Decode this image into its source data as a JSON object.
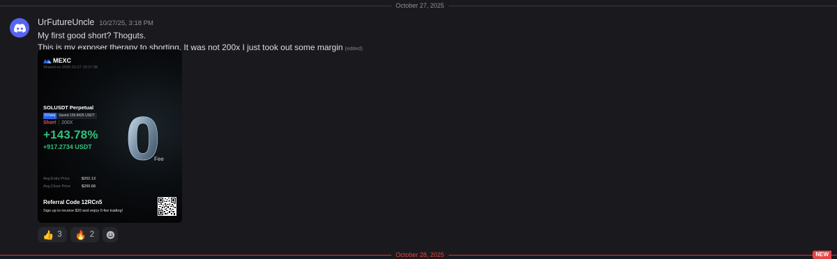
{
  "dividers": {
    "top_date": "October 27, 2025",
    "bottom_date": "October 28, 2025",
    "new_badge": "NEW"
  },
  "message": {
    "author": "UrFutureUncle",
    "timestamp": "10/27/25, 3:18 PM",
    "lines": [
      "My first good short? Thoguts.",
      "This is my exposer therapy to shorting. It was not 200x I just took out some margin"
    ],
    "edited_label": "(edited)"
  },
  "card": {
    "brand": "MEXC",
    "shared_on": "Shared on 2025-10-27 15:17:38",
    "pair": "SOLUSDT Perpetual",
    "fee_badge": "0 Fees",
    "fee_saved": "Saved 139.8425 USDT",
    "direction": "Short",
    "leverage": "200X",
    "pnl_percent": "+143.78%",
    "pnl_usdt": "+917.2734 USDT",
    "big_zero": "0",
    "fee_word": "Fee",
    "avg_entry_label": "Avg.Entry Price",
    "avg_entry_value": "$202.13",
    "avg_close_label": "Avg.Close Price",
    "avg_close_value": "$200.68",
    "referral": "Referral Code 12RCn5",
    "signup": "Sign up to receive $20 and enjoy 0-fee trading!",
    "colors": {
      "profit": "#2fc47c",
      "short": "#f0514f",
      "badge": "#2a62e8"
    }
  },
  "reactions": [
    {
      "emoji": "👍",
      "count": "3",
      "icon": "thumbs-up-icon"
    },
    {
      "emoji": "🔥",
      "count": "2",
      "icon": "fire-icon"
    }
  ],
  "add_reaction_icon": "add-reaction-icon"
}
